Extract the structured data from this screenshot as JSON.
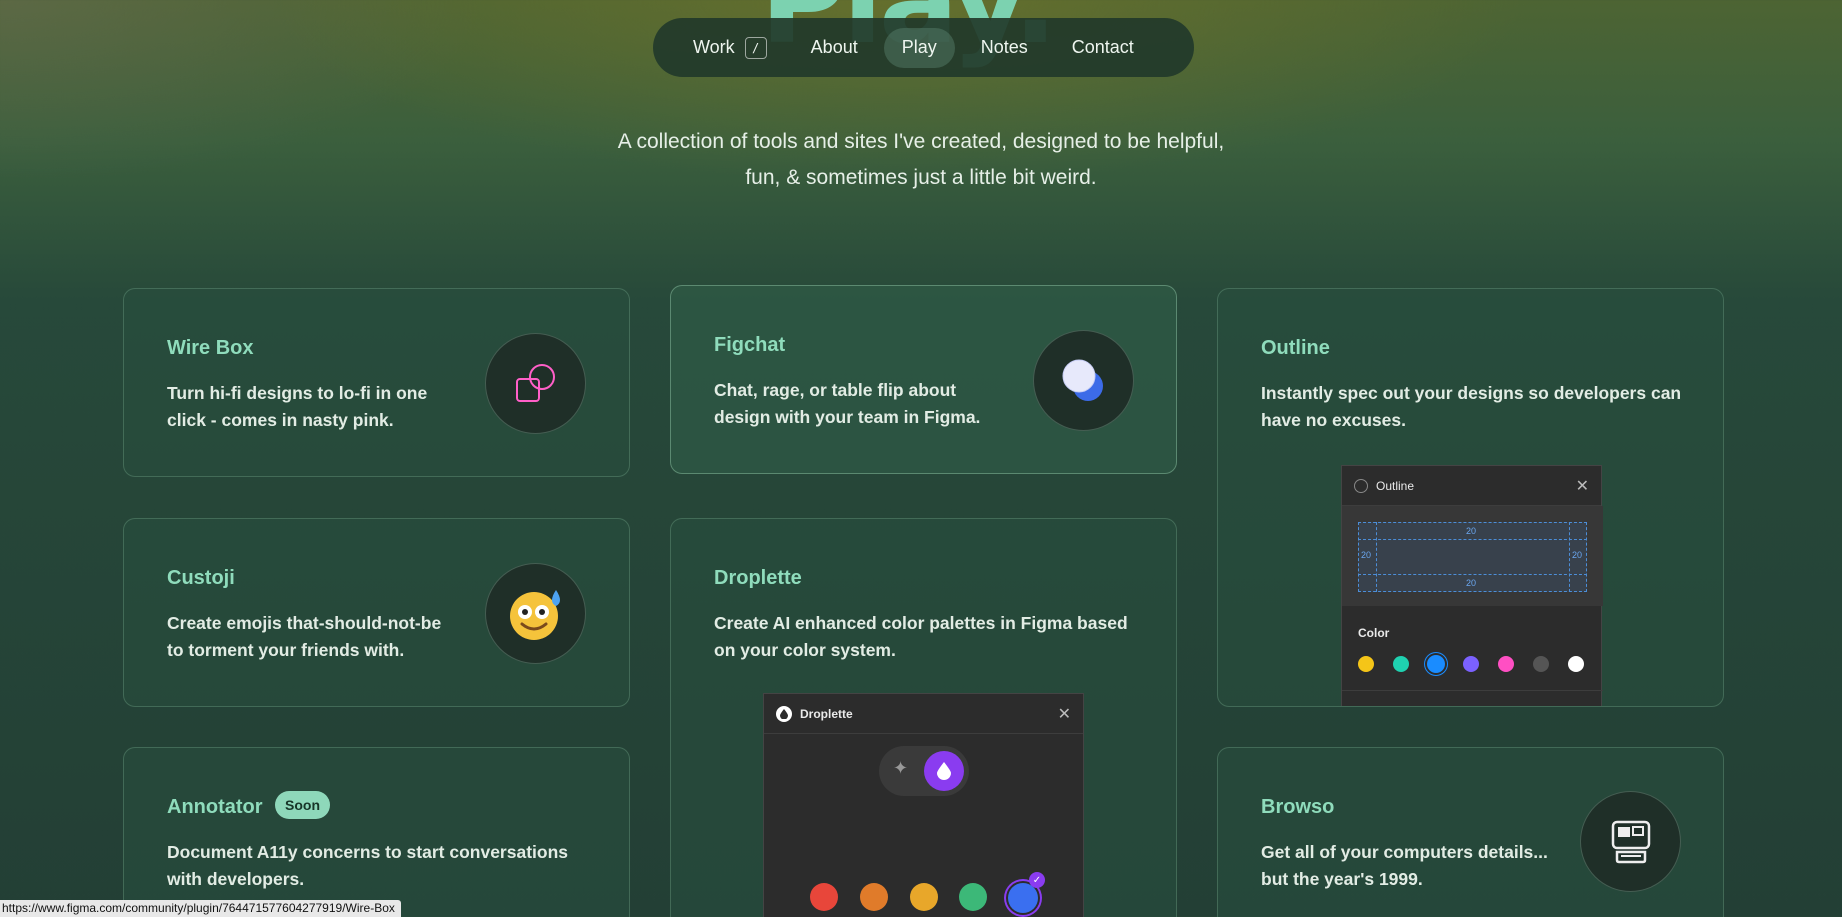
{
  "hero_title": "Play.",
  "nav": {
    "items": [
      {
        "label": "Work",
        "kbd": "/"
      },
      {
        "label": "About"
      },
      {
        "label": "Play"
      },
      {
        "label": "Notes"
      },
      {
        "label": "Contact"
      }
    ]
  },
  "intro": {
    "line1": "A collection of tools and sites I've created, designed to be helpful,",
    "line2": "fun, & sometimes just a little bit weird."
  },
  "cards": {
    "wirebox": {
      "title": "Wire Box",
      "desc_1": "Turn hi-fi designs to lo-fi in one",
      "desc_2": "click - comes in nasty pink."
    },
    "figchat": {
      "title": "Figchat",
      "desc_1": "Chat, rage, or table flip about",
      "desc_2": "design with your team in Figma."
    },
    "outline": {
      "title": "Outline",
      "desc_1": "Instantly spec out your designs so developers can",
      "desc_2": "have no excuses."
    },
    "custoji": {
      "title": "Custoji",
      "desc_1": "Create emojis that-should-not-be",
      "desc_2": "to torment your friends with."
    },
    "droplette": {
      "title": "Droplette",
      "desc_1": "Create AI enhanced color palettes in Figma based",
      "desc_2": "on your color system."
    },
    "annotator": {
      "title": "Annotator",
      "badge": "Soon",
      "desc_1": "Document A11y concerns to start conversations",
      "desc_2": "with developers."
    },
    "browso": {
      "title": "Browso",
      "desc_1": "Get all of your computers details...",
      "desc_2": "but the year's 1999."
    }
  },
  "outline_panel": {
    "title": "Outline",
    "spacing_values": [
      "20",
      "20",
      "20",
      "20"
    ],
    "color_label": "Color",
    "colors": [
      "#f5c518",
      "#1fd1b0",
      "#1a8cff",
      "#7b61ff",
      "#ff4fc3",
      "#555555",
      "#ffffff"
    ]
  },
  "droplette_panel": {
    "title": "Droplette",
    "colors": [
      "#e8463a",
      "#e07b2a",
      "#e8a72a",
      "#3cb878",
      "#3a6ff0"
    ]
  },
  "status_url": "https://www.figma.com/community/plugin/764471577604277919/Wire-Box"
}
